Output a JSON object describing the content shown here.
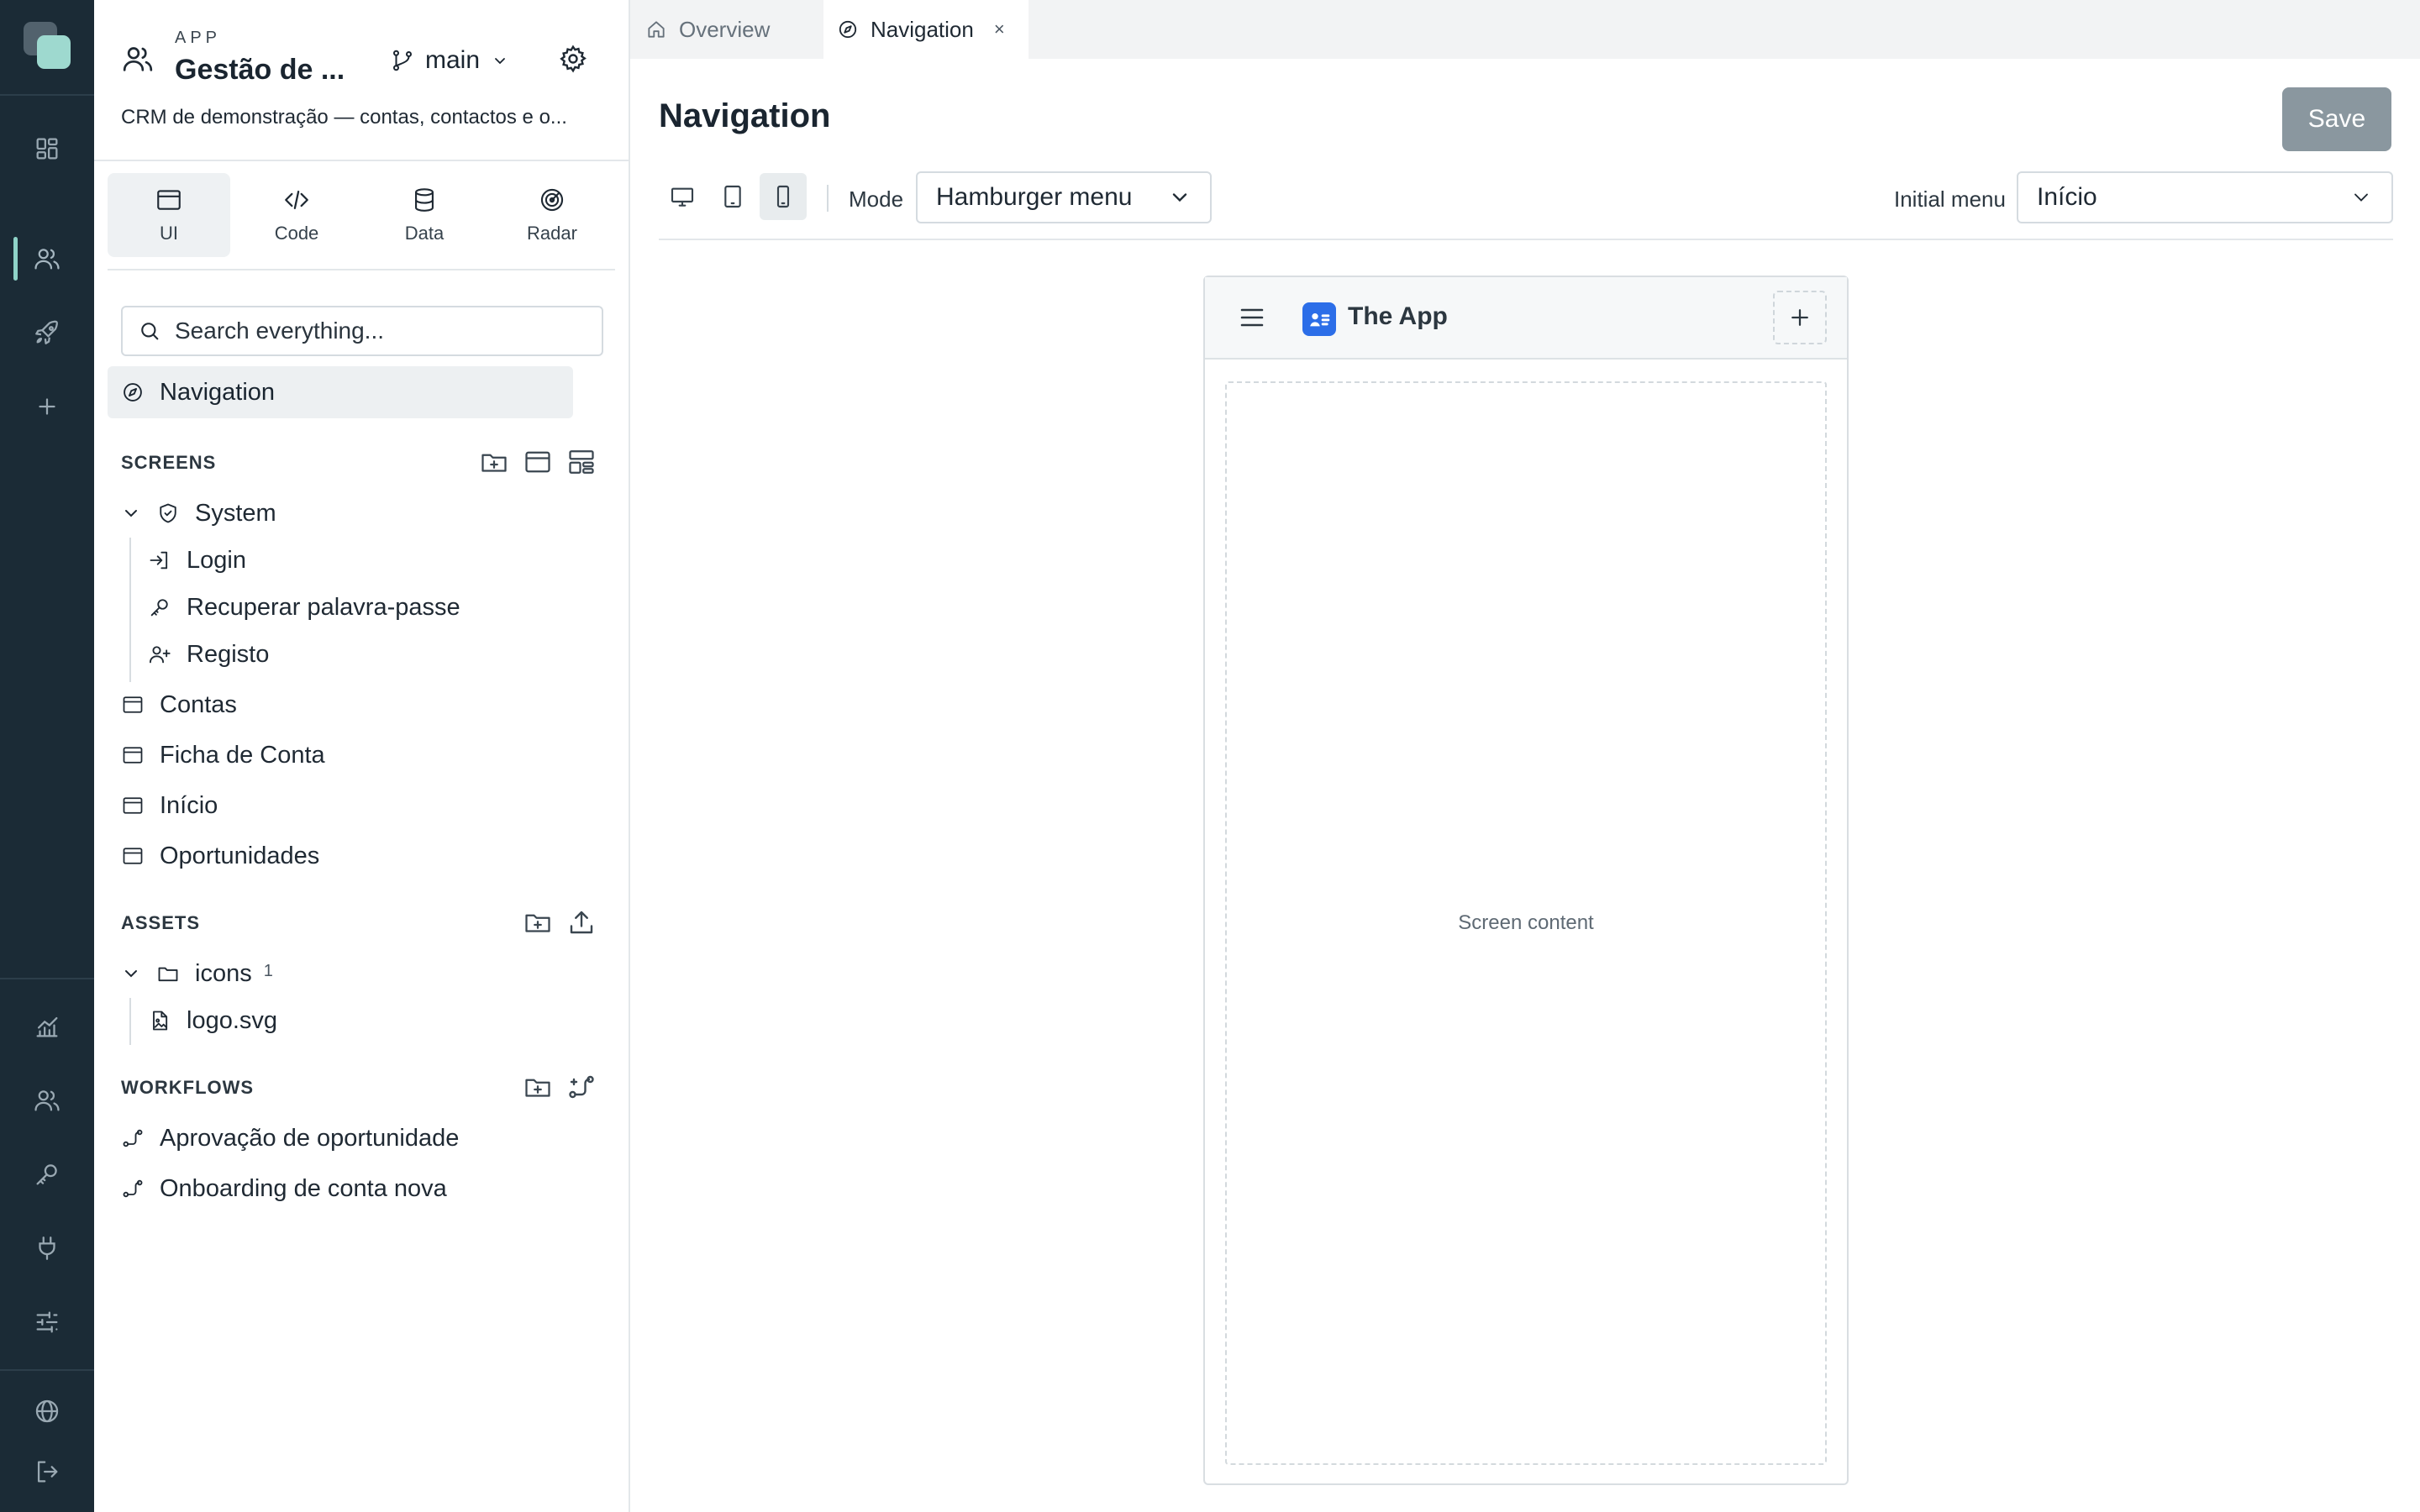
{
  "app": {
    "kicker": "APP",
    "name": "Gestão de ...",
    "branch": "main",
    "description": "CRM de demonstração — contas, contactos e o..."
  },
  "mode_tabs": [
    {
      "label": "UI",
      "icon": "browser-window-icon",
      "active": true
    },
    {
      "label": "Code",
      "icon": "code-icon",
      "active": false
    },
    {
      "label": "Data",
      "icon": "database-icon",
      "active": false
    },
    {
      "label": "Radar",
      "icon": "radar-icon",
      "active": false
    }
  ],
  "search": {
    "placeholder": "Search everything..."
  },
  "navigation_item": {
    "label": "Navigation"
  },
  "sections": {
    "screens": {
      "title": "SCREENS",
      "system_folder": "System",
      "system_items": [
        "Login",
        "Recuperar palavra-passe",
        "Registo"
      ],
      "items": [
        "Contas",
        "Ficha de Conta",
        "Início",
        "Oportunidades"
      ]
    },
    "assets": {
      "title": "ASSETS",
      "folder": "icons",
      "folder_count": "1",
      "files": [
        "logo.svg"
      ]
    },
    "workflows": {
      "title": "WORKFLOWS",
      "items": [
        "Aprovação de oportunidade",
        "Onboarding de conta nova"
      ]
    }
  },
  "editor_tabs": [
    {
      "label": "Overview",
      "icon": "home-icon",
      "active": false
    },
    {
      "label": "Navigation",
      "icon": "compass-icon",
      "active": true,
      "close": "×"
    }
  ],
  "page": {
    "title": "Navigation",
    "save_label": "Save"
  },
  "toolbar": {
    "devices": [
      "desktop",
      "tablet",
      "phone"
    ],
    "active_device": "phone",
    "mode_label": "Mode",
    "mode_value": "Hamburger menu",
    "initial_menu_label": "Initial menu",
    "initial_menu_value": "Início"
  },
  "preview": {
    "app_title": "The App",
    "screen_placeholder": "Screen content"
  },
  "colors": {
    "rail_bg": "#1b2b36",
    "rail_accent": "#8fd3c8",
    "save_button": "#8a979f",
    "app_badge": "#2c6ee8"
  }
}
